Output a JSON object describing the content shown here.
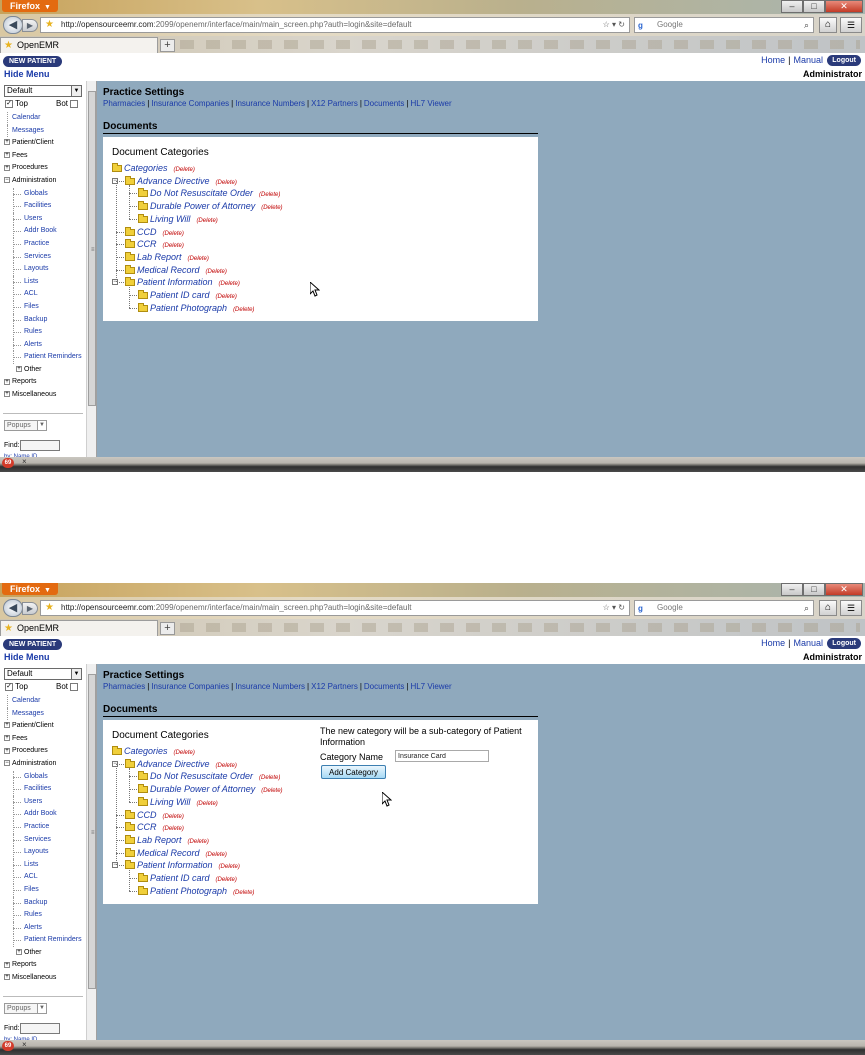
{
  "browser": {
    "menu_label": "Firefox",
    "url_host": "http://opensourceemr.com",
    "url_rest": ":2099/openemr/interface/main/main_screen.php?auth=login&site=default",
    "search_placeholder": "Google",
    "tab_title": "OpenEMR",
    "icons": [
      "back-icon",
      "forward-icon",
      "bookmark-star-icon",
      "reload-icon",
      "search-icon",
      "home-icon",
      "menu-icon"
    ]
  },
  "header": {
    "new_patient": "NEW PATIENT",
    "hide_menu": "Hide Menu",
    "home": "Home",
    "manual": "Manual",
    "logout": "Logout",
    "user": "Administrator"
  },
  "nav": {
    "select_value": "Default",
    "top": "Top",
    "bot": "Bot",
    "items": [
      {
        "label": "Calendar",
        "kind": "lnk"
      },
      {
        "label": "Messages",
        "kind": "lnk"
      },
      {
        "label": "Patient/Client",
        "kind": "top"
      },
      {
        "label": "Fees",
        "kind": "top"
      },
      {
        "label": "Procedures",
        "kind": "top"
      },
      {
        "label": "Administration",
        "kind": "top-open"
      },
      {
        "label": "Globals",
        "kind": "sub"
      },
      {
        "label": "Facilities",
        "kind": "sub"
      },
      {
        "label": "Users",
        "kind": "sub"
      },
      {
        "label": "Addr Book",
        "kind": "sub"
      },
      {
        "label": "Practice",
        "kind": "sub"
      },
      {
        "label": "Services",
        "kind": "sub"
      },
      {
        "label": "Layouts",
        "kind": "sub"
      },
      {
        "label": "Lists",
        "kind": "sub"
      },
      {
        "label": "ACL",
        "kind": "sub"
      },
      {
        "label": "Files",
        "kind": "sub"
      },
      {
        "label": "Backup",
        "kind": "sub"
      },
      {
        "label": "Rules",
        "kind": "sub"
      },
      {
        "label": "Alerts",
        "kind": "sub"
      },
      {
        "label": "Patient Reminders",
        "kind": "sub"
      },
      {
        "label": "Other",
        "kind": "subtop"
      },
      {
        "label": "Reports",
        "kind": "top"
      },
      {
        "label": "Miscellaneous",
        "kind": "top"
      }
    ],
    "popups": "Popups",
    "find_label": "Find:",
    "by_label": "by: Name  ID"
  },
  "main": {
    "title": "Practice Settings",
    "links": [
      "Pharmacies",
      "Insurance Companies",
      "Insurance Numbers",
      "X12 Partners",
      "Documents",
      "HL7 Viewer"
    ],
    "section": "Documents",
    "panel_title": "Document Categories",
    "delete_label": "(Delete)",
    "tree": [
      {
        "label": "Categories",
        "depth": 0
      },
      {
        "label": "Advance Directive",
        "depth": 1
      },
      {
        "label": "Do Not Resuscitate Order",
        "depth": 2
      },
      {
        "label": "Durable Power of Attorney",
        "depth": 2
      },
      {
        "label": "Living Will",
        "depth": 2
      },
      {
        "label": "CCD",
        "depth": 1
      },
      {
        "label": "CCR",
        "depth": 1
      },
      {
        "label": "Lab Report",
        "depth": 1
      },
      {
        "label": "Medical Record",
        "depth": 1
      },
      {
        "label": "Patient Information",
        "depth": 1
      },
      {
        "label": "Patient ID card",
        "depth": 2
      },
      {
        "label": "Patient Photograph",
        "depth": 2
      }
    ]
  },
  "add_category": {
    "message": "The new category will be a sub-category of Patient Information",
    "name_label": "Category Name",
    "name_value": "Insurance Card",
    "button": "Add Category"
  },
  "colors": {
    "page_bg": "#8fa9bd",
    "link": "#1a3aa8",
    "delete": "#c00000",
    "folder": "#f0cf3a"
  }
}
